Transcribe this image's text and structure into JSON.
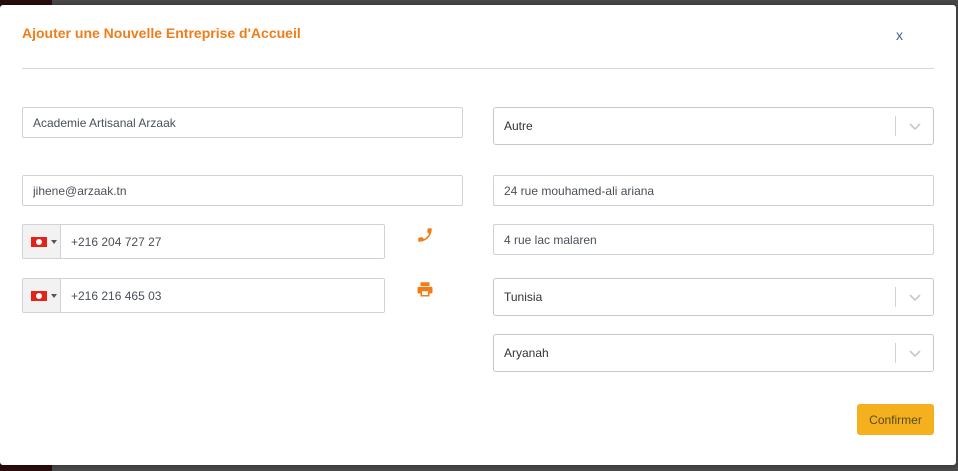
{
  "modal": {
    "title": "Ajouter une Nouvelle Entreprise d'Accueil",
    "close_label": "x"
  },
  "form": {
    "company_name": "Academie Artisanal Arzaak",
    "email": "jihene@arzaak.tn",
    "phone": {
      "country": "tunisia-flag-icon",
      "value": "+216 204 727 27",
      "icon": "phone-icon"
    },
    "fax": {
      "country": "tunisia-flag-icon",
      "value": "+216 216 465 03",
      "icon": "printer-icon"
    },
    "category_select": "Autre",
    "address_line1": "24 rue mouhamed-ali ariana",
    "address_line2": "4 rue lac malaren",
    "country_select": "Tunisia",
    "city_select": "Aryanah"
  },
  "actions": {
    "confirm_label": "Confirmer"
  },
  "colors": {
    "accent": "#f07d1a",
    "button": "#f5b01d",
    "close": "#4a5b8c"
  }
}
